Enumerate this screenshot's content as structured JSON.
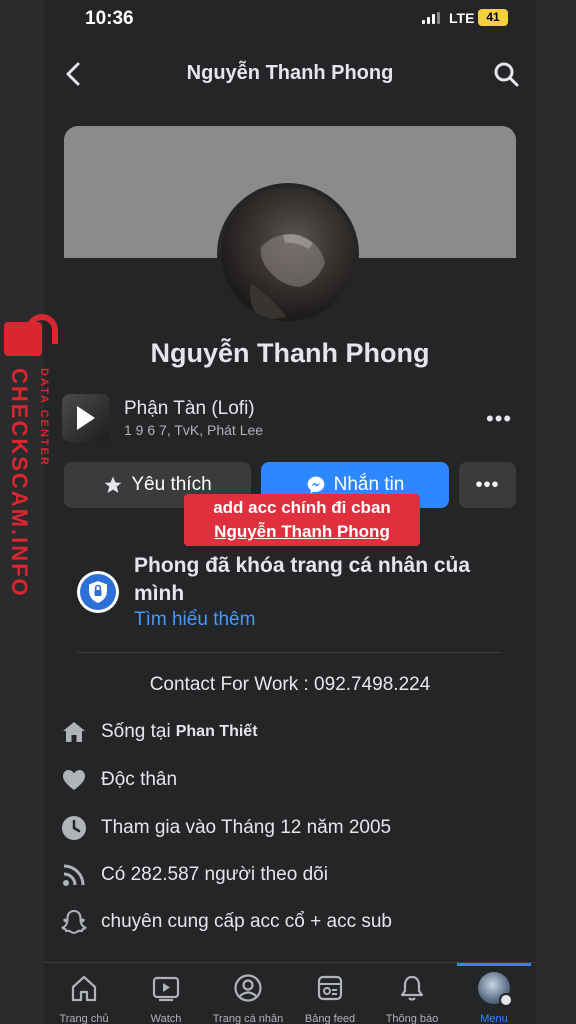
{
  "status_bar": {
    "time": "10:36",
    "network": "LTE",
    "battery": "41"
  },
  "navbar": {
    "title": "Nguyễn Thanh Phong"
  },
  "profile": {
    "name": "Nguyễn Thanh Phong"
  },
  "music": {
    "song": "Phận Tàn (Lofi)",
    "artist": "1 9 6 7, TvK, Phát Lee",
    "more": "•••"
  },
  "actions": {
    "like_label": "Yêu thích",
    "message_label": "Nhắn tin",
    "more_label": "•••"
  },
  "overlay_caption": {
    "line1": "add acc chính đi cban",
    "line2": "Nguyễn Thanh Phong"
  },
  "locked_notice": {
    "title": "Phong đã khóa trang cá nhân của mình",
    "link": "Tìm hiểu thêm"
  },
  "contact": "Contact For Work : 092.7498.224",
  "info": [
    {
      "icon": "home-icon",
      "text": "Sống tại",
      "bold": "Phan Thiết"
    },
    {
      "icon": "heart-icon",
      "text": "Độc thân"
    },
    {
      "icon": "clock-icon",
      "text": "Tham gia vào Tháng 12 năm 2005"
    },
    {
      "icon": "rss-icon",
      "text": "Có 282.587 người theo dõi"
    },
    {
      "icon": "snapchat-icon",
      "text": "chuyên cung cấp acc cổ + acc sub"
    }
  ],
  "tabs": [
    {
      "label": "Trang chủ",
      "icon": "home-icon"
    },
    {
      "label": "Watch",
      "icon": "video-icon"
    },
    {
      "label": "Trang cá nhân",
      "icon": "profile-icon"
    },
    {
      "label": "Bảng feed",
      "icon": "feed-icon"
    },
    {
      "label": "Thông báo",
      "icon": "bell-icon"
    },
    {
      "label": "Menu",
      "icon": "menu-avatar",
      "active": true
    }
  ],
  "watermark": {
    "site": "CHECKSCAM.INFO",
    "subtitle": "DATA CENTER"
  },
  "colors": {
    "background": "#242526",
    "accent": "#2d88ff",
    "caption": "#e0303d",
    "watermark": "#d9262f"
  }
}
